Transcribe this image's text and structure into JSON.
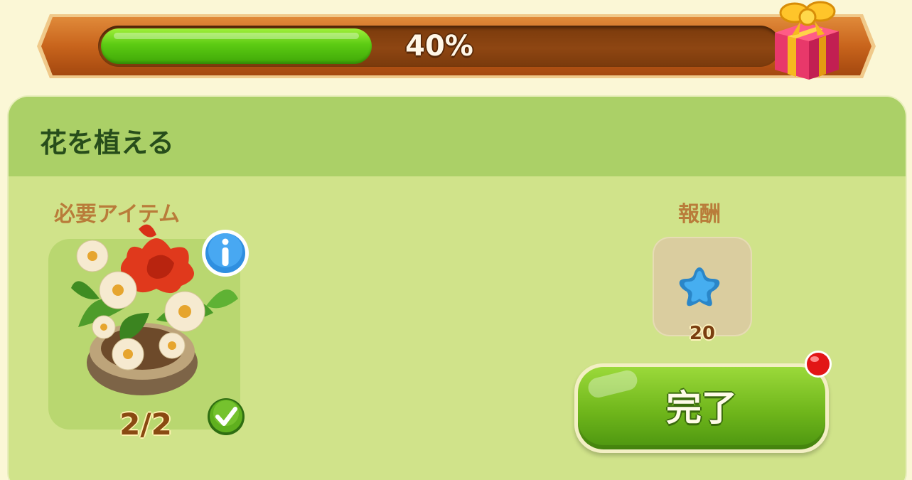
{
  "progress": {
    "label": "40%",
    "fraction": 0.4,
    "fill_color": "#5ccb13",
    "reward_icon": "gift-box-icon"
  },
  "task": {
    "title": "花を植える",
    "required_label": "必要アイテム",
    "required_item": {
      "icon": "flower-planter-icon",
      "count": "2/2",
      "completed": true
    },
    "reward_label": "報酬",
    "reward": {
      "icon": "blue-star-icon",
      "amount": "20"
    },
    "complete_button": "完了",
    "notification": true
  },
  "colors": {
    "background": "#fbf7d6",
    "panel": "#d0e38a",
    "panel_header": "#abd067",
    "title_text": "#274d1b",
    "section_label": "#b97c3a",
    "button_green": "#6fb61b",
    "banner_orange": "#c8641c"
  }
}
